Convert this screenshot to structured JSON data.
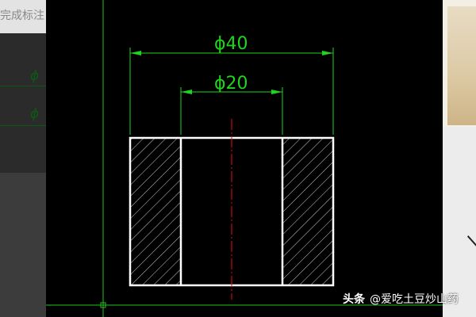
{
  "left_panel": {
    "truncated_text": "完成标注",
    "phi_symbol": "ϕ"
  },
  "drawing": {
    "outer_dimension": "ϕ40",
    "inner_dimension": "ϕ20"
  },
  "watermark": {
    "brand": "头条",
    "handle": "@爱吃土豆炒山药"
  },
  "colors": {
    "canvas_background": "#000000",
    "dimension_green": "#1fd31f",
    "outline_white": "#ffffff",
    "centerline_red": "#e01010"
  }
}
